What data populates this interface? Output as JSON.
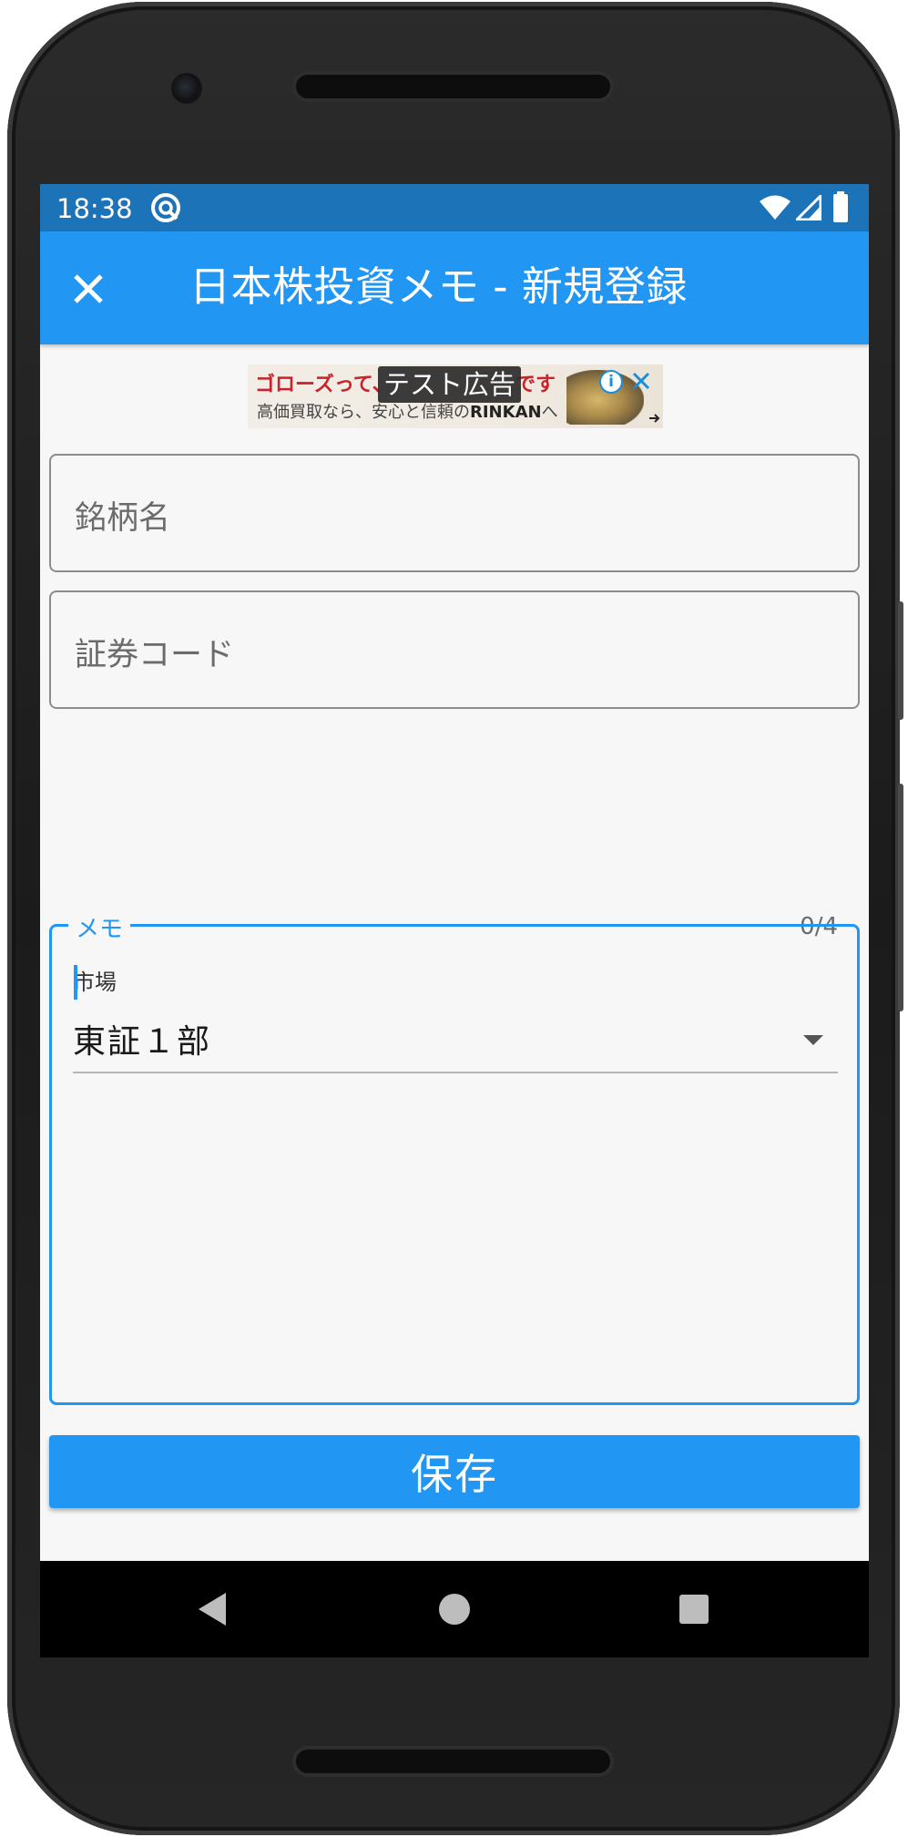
{
  "status_bar": {
    "time": "18:38",
    "icons": [
      "sync-icon",
      "wifi-icon",
      "signal-icon",
      "battery-icon"
    ]
  },
  "app_bar": {
    "close_icon": "close-icon",
    "title": "日本株投資メモ - 新規登録"
  },
  "ad": {
    "line1_left": "ゴローズって、",
    "line1_right": "です",
    "line2_left": "高価買取なら、安心と信頼の",
    "line2_brand": "RINKAN",
    "line2_right": "へ",
    "test_tag": "テスト広告",
    "info_icon": "i"
  },
  "form": {
    "name_field": {
      "label": "銘柄名",
      "value": ""
    },
    "code_field": {
      "label": "証券コード",
      "value": "",
      "counter": "0/4"
    },
    "market": {
      "label": "市場",
      "value": "東証１部"
    },
    "memo": {
      "label": "メモ",
      "value": ""
    },
    "save_button": "保存"
  },
  "colors": {
    "primary": "#2196f3",
    "status_bar": "#1d73b7",
    "background": "#f7f7f7"
  }
}
